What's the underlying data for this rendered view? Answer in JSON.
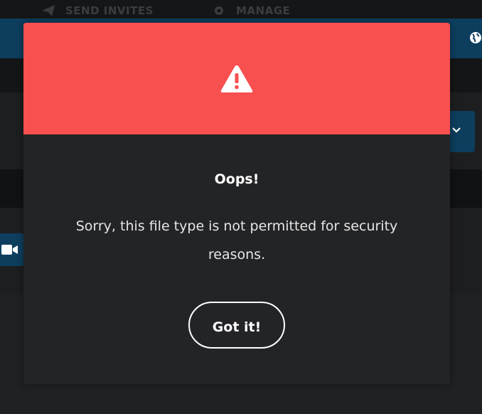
{
  "background": {
    "nav": {
      "send_invites_label": "SEND INVITES",
      "manage_label": "MANAGE",
      "send_icon": "paper-plane-icon",
      "manage_icon": "gear-icon"
    },
    "icons": {
      "globe": "globe-icon",
      "dropdown": "chevron-down-icon",
      "video": "video-camera-icon"
    }
  },
  "modal": {
    "header_icon": "warning-icon",
    "title": "Oops!",
    "message": "Sorry, this file type is not permitted for security reasons.",
    "confirm_label": "Got it!",
    "colors": {
      "header": "#f84f4f",
      "body": "#232426",
      "accent_blue": "#0d3e5e"
    }
  }
}
